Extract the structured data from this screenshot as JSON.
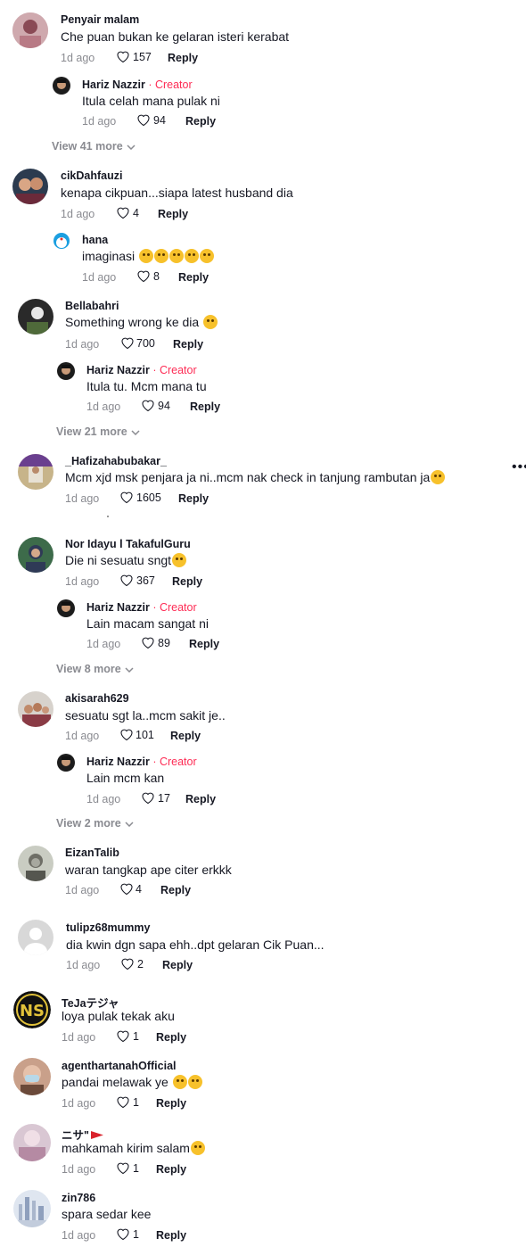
{
  "comments": [
    {
      "user": "Penyair malam",
      "text": "Che puan bukan ke gelaran isteri kerabat",
      "time": "1d ago",
      "likes": "157",
      "reply": "Reply"
    },
    {
      "user": "Hariz Nazzir",
      "creator": " · Creator",
      "text": "Itula celah mana pulak ni",
      "time": "1d ago",
      "likes": "94",
      "reply": "Reply"
    },
    {
      "viewmore": "View 41 more"
    },
    {
      "user": "cikDahfauzi",
      "text": "kenapa cikpuan...siapa latest husband dia",
      "time": "1d ago",
      "likes": "4",
      "reply": "Reply"
    },
    {
      "user": "hana",
      "text": "imaginasi",
      "time": "1d ago",
      "likes": "8",
      "reply": "Reply"
    },
    {
      "user": "Bellabahri",
      "text": "Something wrong ke dia",
      "time": "1d ago",
      "likes": "700",
      "reply": "Reply"
    },
    {
      "user": "Hariz Nazzir",
      "creator": " · Creator",
      "text": "Itula tu. Mcm mana tu",
      "time": "1d ago",
      "likes": "94",
      "reply": "Reply"
    },
    {
      "viewmore": "View 21 more"
    },
    {
      "user": "_Hafizahabubakar_",
      "text": "Mcm xjd msk penjara ja ni..mcm nak check in tanjung rambutan ja",
      "time": "1d ago",
      "likes": "1605",
      "reply": "Reply"
    },
    {
      "user": "Nor Idayu l TakafulGuru",
      "text": "Die ni sesuatu sngt",
      "time": "1d ago",
      "likes": "367",
      "reply": "Reply"
    },
    {
      "user": "Hariz Nazzir",
      "creator": " · Creator",
      "text": "Lain macam sangat ni",
      "time": "1d ago",
      "likes": "89",
      "reply": "Reply"
    },
    {
      "viewmore": "View 8 more"
    },
    {
      "user": "akisarah629",
      "text": "sesuatu sgt la..mcm sakit je..",
      "time": "1d ago",
      "likes": "101",
      "reply": "Reply"
    },
    {
      "user": "Hariz Nazzir",
      "creator": " · Creator",
      "text": "Lain mcm kan",
      "time": "1d ago",
      "likes": "17",
      "reply": "Reply"
    },
    {
      "viewmore": "View 2 more"
    },
    {
      "user": "EizanTalib",
      "text": "waran tangkap ape citer erkkk",
      "time": "1d ago",
      "likes": "4",
      "reply": "Reply"
    },
    {
      "user": "tulipz68mummy",
      "text": "dia kwin dgn sapa ehh..dpt gelaran Cik Puan...",
      "time": "1d ago",
      "likes": "2",
      "reply": "Reply"
    },
    {
      "user": "TeJaテジャ",
      "text": "loya pulak tekak aku",
      "time": "1d ago",
      "likes": "1",
      "reply": "Reply"
    },
    {
      "user": "agenthartanahOfficial",
      "text": "pandai melawak ye",
      "time": "1d ago",
      "likes": "1",
      "reply": "Reply"
    },
    {
      "user": "ニサ\"",
      "text": "mahkamah kirim salam",
      "time": "1d ago",
      "likes": "1",
      "reply": "Reply"
    },
    {
      "user": "zin786",
      "text": "spara sedar kee",
      "time": "1d ago",
      "likes": "1",
      "reply": "Reply"
    }
  ],
  "menu_icon": "more-dots-icon"
}
